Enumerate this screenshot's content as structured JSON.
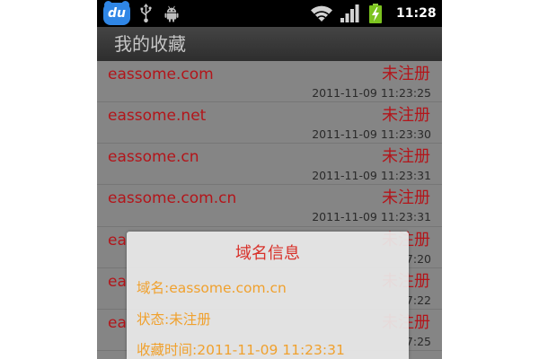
{
  "status_bar": {
    "app_icon_label": "du",
    "time": "11:28",
    "icons": {
      "app": "du-app-icon",
      "usb": "usb-icon",
      "debug": "android-debug-icon",
      "wifi": "wifi-icon",
      "signal": "signal-strength-icon",
      "battery": "battery-charging-icon"
    }
  },
  "title_bar": {
    "title": "我的收藏"
  },
  "favorites": [
    {
      "domain": "eassome.com",
      "status": "未注册",
      "saved_time": "2011-11-09 11:23:25"
    },
    {
      "domain": "eassome.net",
      "status": "未注册",
      "saved_time": "2011-11-09 11:23:30"
    },
    {
      "domain": "eassome.cn",
      "status": "未注册",
      "saved_time": "2011-11-09 11:23:31"
    },
    {
      "domain": "eassome.com.cn",
      "status": "未注册",
      "saved_time": "2011-11-09 11:23:31"
    },
    {
      "domain": "ea",
      "status": "未注册",
      "saved_time": "7:20"
    },
    {
      "domain": "ea",
      "status": "未注册",
      "saved_time": "7:22"
    },
    {
      "domain": "ea",
      "status": "未注册",
      "saved_time": "7:25"
    }
  ],
  "dialog": {
    "title": "域名信息",
    "fields": [
      {
        "label": "域名:",
        "value": "eassome.com.cn"
      },
      {
        "label": "状态:",
        "value": "未注册"
      },
      {
        "label": "收藏时间:",
        "value": "2011-11-09 11:23:31"
      }
    ]
  },
  "colors": {
    "status_bar": "#000000",
    "list_background": "#858585",
    "domain_text": "#b3151a",
    "status_text": "#b3151a",
    "time_text": "#2a2a2a",
    "dialog_title": "#d8312a",
    "dialog_field_text": "#f0a12e",
    "app_icon": "#2f86e6",
    "battery": "#7cc31f"
  }
}
